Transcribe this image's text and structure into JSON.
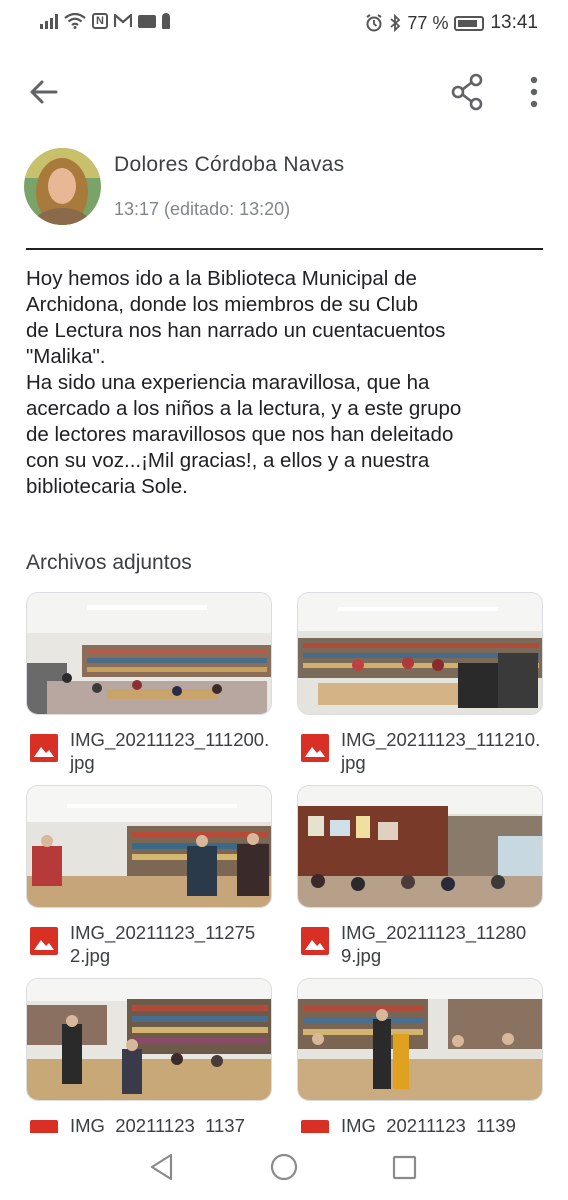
{
  "status_bar": {
    "battery": "77 %",
    "time": "13:41"
  },
  "icons": {
    "back": "arrow-back-icon",
    "share": "share-icon",
    "more": "more-vert-icon",
    "image_file": "image-file-icon",
    "nav_back": "triangle-back-icon",
    "nav_home": "circle-home-icon",
    "nav_recents": "square-recents-icon"
  },
  "post": {
    "author": "Dolores Córdoba Navas",
    "time": "13:17 (editado: 13:20)",
    "body": "Hoy hemos ido a la Biblioteca Municipal de\nArchidona, donde los miembros de su Club\nde Lectura nos han narrado un cuentacuentos\n\"Malika\".\nHa sido una experiencia maravillosa, que ha\nacercado a los niños a la lectura, y a este grupo\nde lectores maravillosos que nos han deleitado\ncon su voz...¡Mil gracias!, a ellos y a nuestra\nbibliotecaria Sole."
  },
  "attachments": {
    "title": "Archivos adjuntos",
    "files": [
      {
        "name": "IMG_20211123_111200.jpg"
      },
      {
        "name": "IMG_20211123_111210.jpg"
      },
      {
        "name": "IMG_20211123_112752.jpg"
      },
      {
        "name": "IMG_20211123_112809.jpg"
      },
      {
        "name": "IMG_20211123_1137"
      },
      {
        "name": "IMG_20211123_1139"
      }
    ]
  },
  "colors": {
    "image_icon": "#d93025",
    "text_primary": "#202124",
    "text_secondary": "#80868b"
  }
}
